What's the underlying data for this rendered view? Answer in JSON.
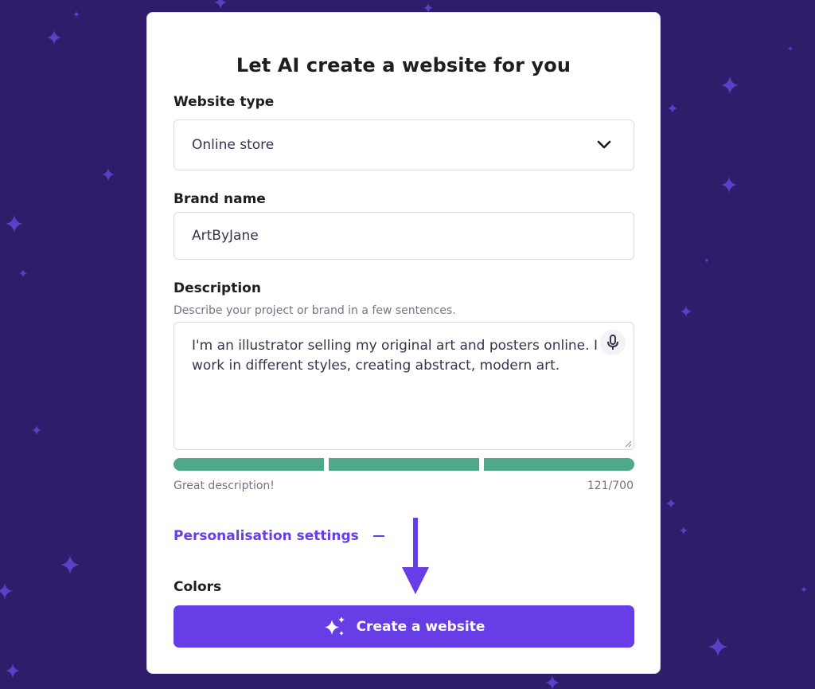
{
  "form": {
    "title": "Let AI create a website for you",
    "website_type": {
      "label": "Website type",
      "selected_value": "Online store",
      "icon": "chevron-down-icon"
    },
    "brand_name": {
      "label": "Brand name",
      "value": "ArtByJane"
    },
    "description": {
      "label": "Description",
      "hint": "Describe your project or brand in a few sentences.",
      "value": "I'm an illustrator selling my original art and posters online. I work in different styles, creating abstract, modern art.",
      "mic_icon": "microphone-icon",
      "quality_segments_filled": 3,
      "quality_segments_total": 3,
      "quality_label": "Great description!",
      "char_count": "121/700"
    },
    "personalisation": {
      "label": "Personalisation settings",
      "icon": "minus-icon"
    },
    "colors": {
      "label": "Colors"
    },
    "submit": {
      "label": "Create a website",
      "icon": "sparkles-icon"
    }
  },
  "colors": {
    "background": "#2f1c6a",
    "accent": "#673de6",
    "meter": "#4fa88b",
    "card": "#ffffff"
  }
}
